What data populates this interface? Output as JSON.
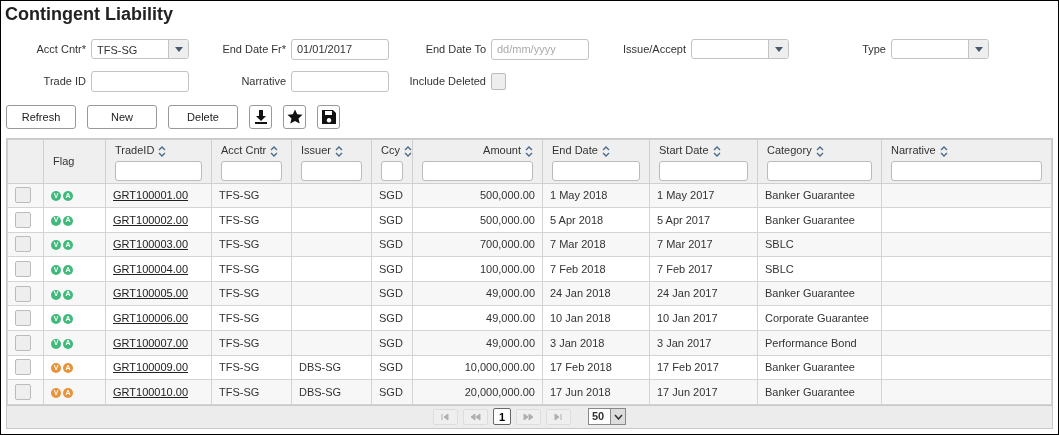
{
  "title": "Contingent Liability",
  "filters": [
    {
      "kind": "select",
      "label": "Acct Cntr*",
      "value": "TFS-SG"
    },
    {
      "kind": "text",
      "label": "End Date Fr*",
      "value": "01/01/2017"
    },
    {
      "kind": "text",
      "label": "End Date To",
      "placeholder": "dd/mm/yyyy"
    },
    {
      "kind": "select",
      "label": "Issue/Accept"
    },
    {
      "kind": "select",
      "label": "Type"
    },
    {
      "kind": "text",
      "label": "Trade ID"
    },
    {
      "kind": "text",
      "label": "Narrative"
    },
    {
      "kind": "checkbox",
      "label": "Include Deleted",
      "checked": false
    }
  ],
  "buttons": [
    {
      "kind": "text",
      "label": "Refresh"
    },
    {
      "kind": "text",
      "label": "New"
    },
    {
      "kind": "text",
      "label": "Delete"
    },
    {
      "kind": "download"
    },
    {
      "kind": "star"
    },
    {
      "kind": "save"
    }
  ],
  "table": {
    "columns": [
      {
        "kind": "flag",
        "label": "Flag"
      },
      {
        "kind": "text",
        "label": "TradeID"
      },
      {
        "kind": "text",
        "label": "Acct Cntr"
      },
      {
        "kind": "text",
        "label": "Issuer"
      },
      {
        "kind": "text",
        "label": "Ccy"
      },
      {
        "kind": "number",
        "label": "Amount"
      },
      {
        "kind": "text",
        "label": "End Date"
      },
      {
        "kind": "text",
        "label": "Start Date"
      },
      {
        "kind": "text",
        "label": "Category"
      },
      {
        "kind": "text",
        "label": "Narrative"
      }
    ],
    "rows": [
      {
        "checked": false,
        "flags": [
          {
            "letter": "V",
            "color": "#3fba7a"
          },
          {
            "letter": "A",
            "color": "#3fba7a"
          }
        ],
        "trade_id": "GRT100001.00",
        "acct_cntr": "TFS-SG",
        "ccy": "SGD",
        "amount": "500,000.00",
        "end_date": "1 May 2018",
        "start_date": "1 May 2017",
        "category": "Banker Guarantee"
      },
      {
        "checked": false,
        "flags": [
          {
            "letter": "V",
            "color": "#3fba7a"
          },
          {
            "letter": "A",
            "color": "#3fba7a"
          }
        ],
        "trade_id": "GRT100002.00",
        "acct_cntr": "TFS-SG",
        "ccy": "SGD",
        "amount": "500,000.00",
        "end_date": "5 Apr 2018",
        "start_date": "5 Apr 2017",
        "category": "Banker Guarantee"
      },
      {
        "checked": false,
        "flags": [
          {
            "letter": "V",
            "color": "#3fba7a"
          },
          {
            "letter": "A",
            "color": "#3fba7a"
          }
        ],
        "trade_id": "GRT100003.00",
        "acct_cntr": "TFS-SG",
        "ccy": "SGD",
        "amount": "700,000.00",
        "end_date": "7 Mar 2018",
        "start_date": "7 Mar 2017",
        "category": "SBLC"
      },
      {
        "checked": false,
        "flags": [
          {
            "letter": "V",
            "color": "#3fba7a"
          },
          {
            "letter": "A",
            "color": "#3fba7a"
          }
        ],
        "trade_id": "GRT100004.00",
        "acct_cntr": "TFS-SG",
        "ccy": "SGD",
        "amount": "100,000.00",
        "end_date": "7 Feb 2018",
        "start_date": "7 Feb 2017",
        "category": "SBLC"
      },
      {
        "checked": false,
        "flags": [
          {
            "letter": "V",
            "color": "#3fba7a"
          },
          {
            "letter": "A",
            "color": "#3fba7a"
          }
        ],
        "trade_id": "GRT100005.00",
        "acct_cntr": "TFS-SG",
        "ccy": "SGD",
        "amount": "49,000.00",
        "end_date": "24 Jan 2018",
        "start_date": "24 Jan 2017",
        "category": "Banker Guarantee"
      },
      {
        "checked": false,
        "flags": [
          {
            "letter": "V",
            "color": "#3fba7a"
          },
          {
            "letter": "A",
            "color": "#3fba7a"
          }
        ],
        "trade_id": "GRT100006.00",
        "acct_cntr": "TFS-SG",
        "ccy": "SGD",
        "amount": "49,000.00",
        "end_date": "10 Jan 2018",
        "start_date": "10 Jan 2017",
        "category": "Corporate Guarantee"
      },
      {
        "checked": false,
        "flags": [
          {
            "letter": "V",
            "color": "#3fba7a"
          },
          {
            "letter": "A",
            "color": "#3fba7a"
          }
        ],
        "trade_id": "GRT100007.00",
        "acct_cntr": "TFS-SG",
        "ccy": "SGD",
        "amount": "49,000.00",
        "end_date": "3 Jan 2018",
        "start_date": "3 Jan 2017",
        "category": "Performance Bond"
      },
      {
        "checked": false,
        "flags": [
          {
            "letter": "V",
            "color": "#e8923a"
          },
          {
            "letter": "A",
            "color": "#e8923a"
          }
        ],
        "trade_id": "GRT100009.00",
        "acct_cntr": "TFS-SG",
        "issuer": "DBS-SG",
        "ccy": "SGD",
        "amount": "10,000,000.00",
        "end_date": "17 Feb 2018",
        "start_date": "17 Feb 2017",
        "category": "Banker Guarantee"
      },
      {
        "checked": false,
        "flags": [
          {
            "letter": "V",
            "color": "#e8923a"
          },
          {
            "letter": "A",
            "color": "#e8923a"
          }
        ],
        "trade_id": "GRT100010.00",
        "acct_cntr": "TFS-SG",
        "issuer": "DBS-SG",
        "ccy": "SGD",
        "amount": "20,000,000.00",
        "end_date": "17 Jun 2018",
        "start_date": "17 Jun 2017",
        "category": "Banker Guarantee"
      }
    ]
  },
  "pager": {
    "buttons": [
      {
        "kind": "first",
        "disabled": true
      },
      {
        "kind": "prev",
        "disabled": true
      },
      {
        "kind": "page",
        "label": "1",
        "selected": true
      },
      {
        "kind": "next",
        "disabled": true
      },
      {
        "kind": "last",
        "disabled": true
      }
    ],
    "page_size": "50"
  }
}
